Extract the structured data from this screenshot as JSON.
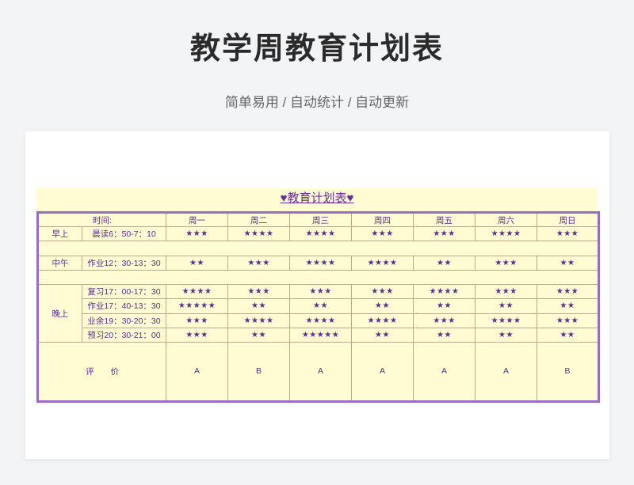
{
  "header": {
    "title": "教学周教育计划表",
    "subtitle": "简单易用 / 自动统计 / 自动更新"
  },
  "sheet": {
    "title": "♥教育计划表♥",
    "time_label": "时间:",
    "days": [
      "周一",
      "周二",
      "周三",
      "周四",
      "周五",
      "周六",
      "周日"
    ],
    "morning": {
      "period": "早上",
      "time": "晨读6：50-7：10",
      "stars": [
        "★★★",
        "★★★★",
        "★★★★",
        "★★★",
        "★★★",
        "★★★★",
        "★★★"
      ]
    },
    "noon": {
      "period": "中午",
      "time": "作业12：30-13：30",
      "stars": [
        "★★",
        "★★★",
        "★★★★",
        "★★★★",
        "★★",
        "★★★",
        "★★"
      ]
    },
    "evening": {
      "period": "晚上",
      "rows": [
        {
          "time": "复习17：00-17：30",
          "stars": [
            "★★★★",
            "★★★",
            "★★★",
            "★★★",
            "★★★★",
            "★★★",
            "★★★"
          ]
        },
        {
          "time": "作业17：40-13：30",
          "stars": [
            "★★★★★",
            "★★",
            "★★",
            "★★",
            "★★",
            "★★",
            "★★"
          ]
        },
        {
          "time": "业余19：30-20：30",
          "stars": [
            "★★★",
            "★★★★",
            "★★★★",
            "★★★★",
            "★★★",
            "★★★★",
            "★★★"
          ]
        },
        {
          "time": "预习20：30-21：00",
          "stars": [
            "★★★",
            "★★",
            "★★★★★",
            "★★",
            "★★",
            "★★",
            "★★"
          ]
        }
      ]
    },
    "evaluation": {
      "label": "评　　价",
      "grades": [
        "A",
        "B",
        "A",
        "A",
        "A",
        "A",
        "B"
      ]
    }
  },
  "colors": {
    "sheet_bg": "#fffbd2",
    "accent": "#9b6cc6",
    "text": "#5b2d8e"
  }
}
